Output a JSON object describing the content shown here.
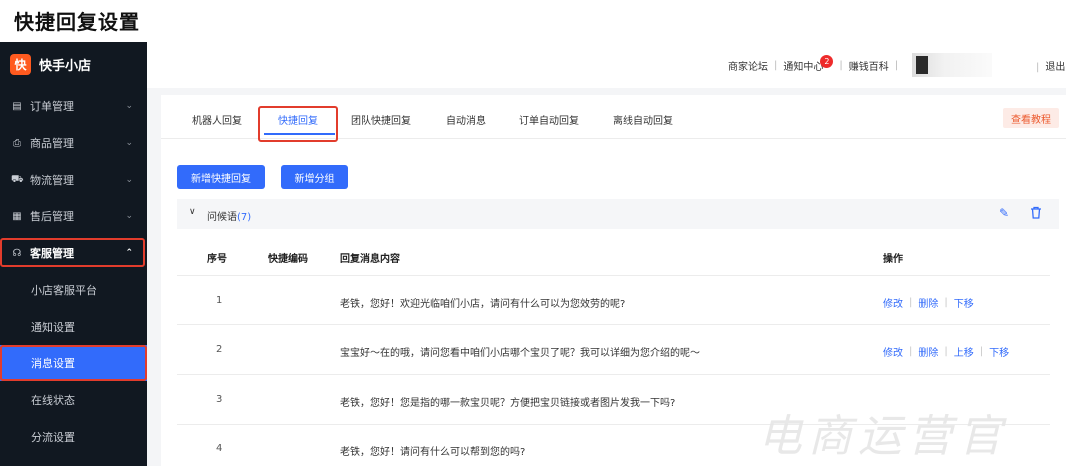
{
  "page_title": "快捷回复设置",
  "brand": {
    "logo": "快",
    "name": "快手小店"
  },
  "sidebar": {
    "items": [
      {
        "label": "订单管理",
        "icon": "order-icon",
        "glyph": "▤",
        "chevron": "⌄"
      },
      {
        "label": "商品管理",
        "icon": "goods-icon",
        "glyph": "⎙",
        "chevron": "⌄"
      },
      {
        "label": "物流管理",
        "icon": "truck-icon",
        "glyph": "⛟",
        "chevron": "⌄"
      },
      {
        "label": "售后管理",
        "icon": "aftersale-icon",
        "glyph": "▦",
        "chevron": "⌄"
      },
      {
        "label": "客服管理",
        "icon": "headset-icon",
        "glyph": "☊",
        "chevron": "⌃"
      }
    ],
    "sub_items": [
      "小店客服平台",
      "通知设置",
      "消息设置",
      "在线状态",
      "分流设置"
    ]
  },
  "topbar": {
    "forum": "商家论坛",
    "notice": "通知中心",
    "notice_badge": "2",
    "wiki": "赚钱百科",
    "sep": "|",
    "logout": "退出"
  },
  "tabs": [
    "机器人回复",
    "快捷回复",
    "团队快捷回复",
    "自动消息",
    "订单自动回复",
    "离线自动回复"
  ],
  "tutorial_label": "查看教程",
  "buttons": {
    "add_reply": "新增快捷回复",
    "add_group": "新增分组"
  },
  "group": {
    "name": "问候语",
    "count": "(7)",
    "chevron": "∨",
    "edit_icon": "✎",
    "delete_icon": "🗑"
  },
  "table": {
    "headers": {
      "index": "序号",
      "code": "快捷编码",
      "content": "回复消息内容",
      "actions": "操作"
    },
    "rows": [
      {
        "index": "1",
        "content": "老铁，您好！欢迎光临咱们小店，请问有什么可以为您效劳的呢?",
        "actions": [
          "修改",
          "删除",
          "下移"
        ]
      },
      {
        "index": "2",
        "content": "宝宝好～在的哦，请问您看中咱们小店哪个宝贝了呢？我可以详细为您介绍的呢～",
        "actions": [
          "修改",
          "删除",
          "上移",
          "下移"
        ]
      },
      {
        "index": "3",
        "content": "老铁，您好！您是指的哪一款宝贝呢？方便把宝贝链接或者图片发我一下吗?",
        "actions": []
      },
      {
        "index": "4",
        "content": "老铁，您好！请问有什么可以帮到您的吗?",
        "actions": []
      }
    ]
  },
  "watermark": "电商运营官",
  "colors": {
    "accent": "#326bfb",
    "sidebar_bg": "#111821",
    "highlight_box": "#e23c2c",
    "brand": "#ff5a1f"
  }
}
